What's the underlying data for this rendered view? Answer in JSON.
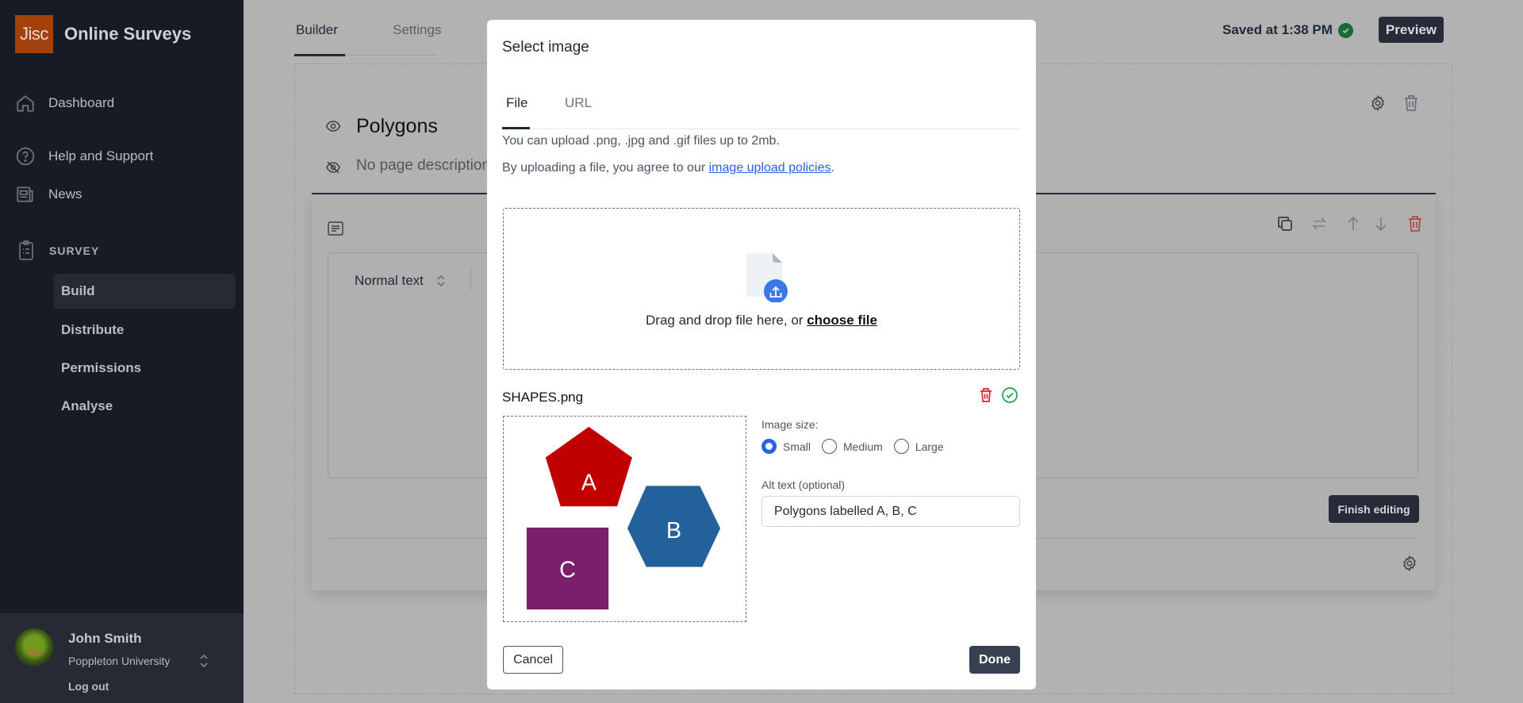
{
  "sidebar": {
    "logo": "Jisc",
    "app_title": "Online Surveys",
    "nav": [
      {
        "label": "Dashboard",
        "icon": "home-icon"
      },
      {
        "label": "Help and Support",
        "icon": "help-circle-icon"
      },
      {
        "label": "News",
        "icon": "newspaper-icon"
      }
    ],
    "section_label": "SURVEY",
    "section_items": [
      {
        "label": "Build",
        "active": true
      },
      {
        "label": "Distribute",
        "active": false
      },
      {
        "label": "Permissions",
        "active": false
      },
      {
        "label": "Analyse",
        "active": false
      }
    ],
    "user": {
      "name": "John Smith",
      "organisation": "Poppleton University",
      "logout_label": "Log out"
    }
  },
  "header": {
    "tabs": [
      {
        "label": "Builder",
        "active": true
      },
      {
        "label": "Settings",
        "active": false
      }
    ],
    "saved_status": "Saved at 1:38 PM",
    "preview_label": "Preview"
  },
  "page": {
    "title": "Polygons",
    "description_placeholder": "No page description",
    "question": {
      "format_select": "Normal text",
      "finish_label": "Finish editing"
    }
  },
  "modal": {
    "title": "Select image",
    "tabs": [
      {
        "label": "File",
        "active": true
      },
      {
        "label": "URL",
        "active": false
      }
    ],
    "info_line": "You can upload .png, .jpg and .gif files up to 2mb.",
    "policy_prefix": "By uploading a file, you agree to our ",
    "policy_link": "image upload policies",
    "policy_suffix": ".",
    "dropzone_text": "Drag and drop file here, or ",
    "dropzone_link": "choose file",
    "file_name": "SHAPES.png",
    "preview_shapes": [
      {
        "label": "A",
        "shape": "pentagon",
        "color": "#c00000"
      },
      {
        "label": "B",
        "shape": "hexagon",
        "color": "#22619b"
      },
      {
        "label": "C",
        "shape": "square",
        "color": "#7a1f6b"
      }
    ],
    "image_size_label": "Image size:",
    "image_size_options": [
      {
        "label": "Small",
        "checked": true
      },
      {
        "label": "Medium",
        "checked": false
      },
      {
        "label": "Large",
        "checked": false
      }
    ],
    "alt_label": "Alt text (optional)",
    "alt_value": "Polygons labelled A, B, C",
    "cancel_label": "Cancel",
    "done_label": "Done"
  },
  "colors": {
    "sidebar_bg": "#171b24",
    "brand": "#a3410d",
    "primary_button": "#262b37",
    "link": "#2563eb",
    "success": "#1b6a33",
    "danger": "#dc2626"
  }
}
